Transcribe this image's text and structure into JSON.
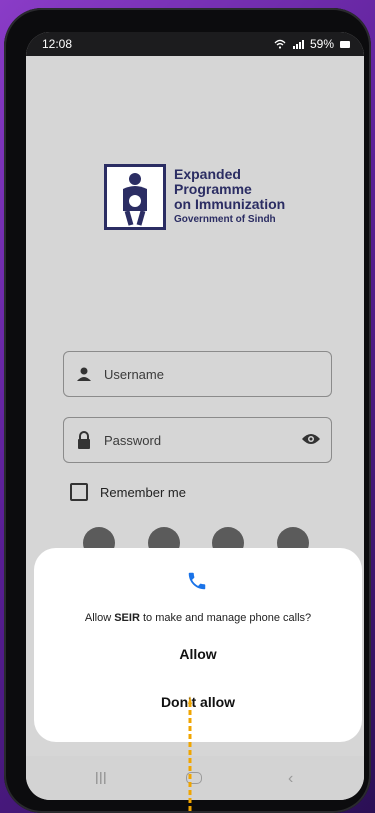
{
  "status": {
    "time": "12:08",
    "battery": "59%"
  },
  "logo": {
    "line1": "Expanded",
    "line2": "Programme",
    "line3": "on Immunization",
    "line4": "Government of Sindh"
  },
  "login": {
    "username_placeholder": "Username",
    "password_placeholder": "Password",
    "remember_label": "Remember me"
  },
  "dialog": {
    "app_name": "SEIR",
    "prefix": "Allow",
    "suffix": "to make and manage phone calls?",
    "allow": "Allow",
    "deny": "Don't allow"
  },
  "colors": {
    "brand": "#2b2d63",
    "call_icon": "#1a73e8",
    "annotation_arrow": "#f0a500"
  }
}
